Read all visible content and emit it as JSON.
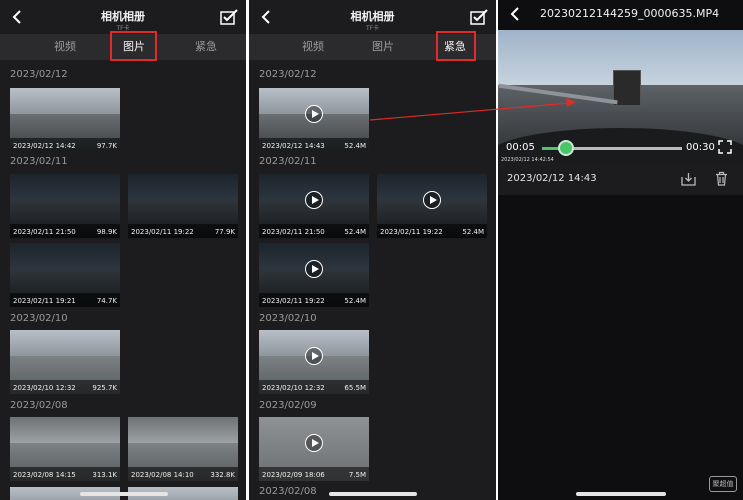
{
  "album": {
    "title": "相机相册",
    "subtitle": "TF卡",
    "tabs": [
      "视频",
      "图片",
      "紧急"
    ]
  },
  "panel1": {
    "active_tab": "图片",
    "groups": [
      {
        "date": "2023/02/12",
        "items": [
          {
            "time": "2023/02/12 14:42",
            "size": "97.7K"
          }
        ]
      },
      {
        "date": "2023/02/11",
        "items": [
          {
            "time": "2023/02/11 21:50",
            "size": "98.9K"
          },
          {
            "time": "2023/02/11 19:22",
            "size": "77.9K"
          },
          {
            "time": "2023/02/11 19:21",
            "size": "74.7K"
          }
        ]
      },
      {
        "date": "2023/02/10",
        "items": [
          {
            "time": "2023/02/10 12:32",
            "size": "925.7K"
          }
        ]
      },
      {
        "date": "2023/02/08",
        "items": [
          {
            "time": "2023/02/08 14:15",
            "size": "313.1K"
          },
          {
            "time": "2023/02/08 14:10",
            "size": "332.8K"
          }
        ]
      }
    ]
  },
  "panel2": {
    "active_tab": "紧急",
    "groups": [
      {
        "date": "2023/02/12",
        "items": [
          {
            "time": "2023/02/12 14:43",
            "size": "52.4M"
          }
        ]
      },
      {
        "date": "2023/02/11",
        "items": [
          {
            "time": "2023/02/11 21:50",
            "size": "52.4M"
          },
          {
            "time": "2023/02/11 19:22",
            "size": "52.4M"
          },
          {
            "time": "2023/02/11 19:22",
            "size": "52.4M"
          }
        ]
      },
      {
        "date": "2023/02/10",
        "items": [
          {
            "time": "2023/02/10 12:32",
            "size": "65.5M"
          }
        ]
      },
      {
        "date": "2023/02/09",
        "items": [
          {
            "time": "2023/02/09 18:06",
            "size": "7.5M"
          }
        ]
      },
      {
        "date": "2023/02/08",
        "items": []
      }
    ]
  },
  "player": {
    "filename": "20230212144259_0000635.MP4",
    "current_time": "00:05",
    "total_time": "00:30",
    "progress": 0.17,
    "overlay_text": "2023/02/12 14:42:54",
    "date": "2023/02/12 14:43"
  },
  "watermark": "聚超值",
  "colors": {
    "accent_green": "#4cc46a",
    "highlight_red": "#e12a2a",
    "background": "#1c1c1e"
  }
}
